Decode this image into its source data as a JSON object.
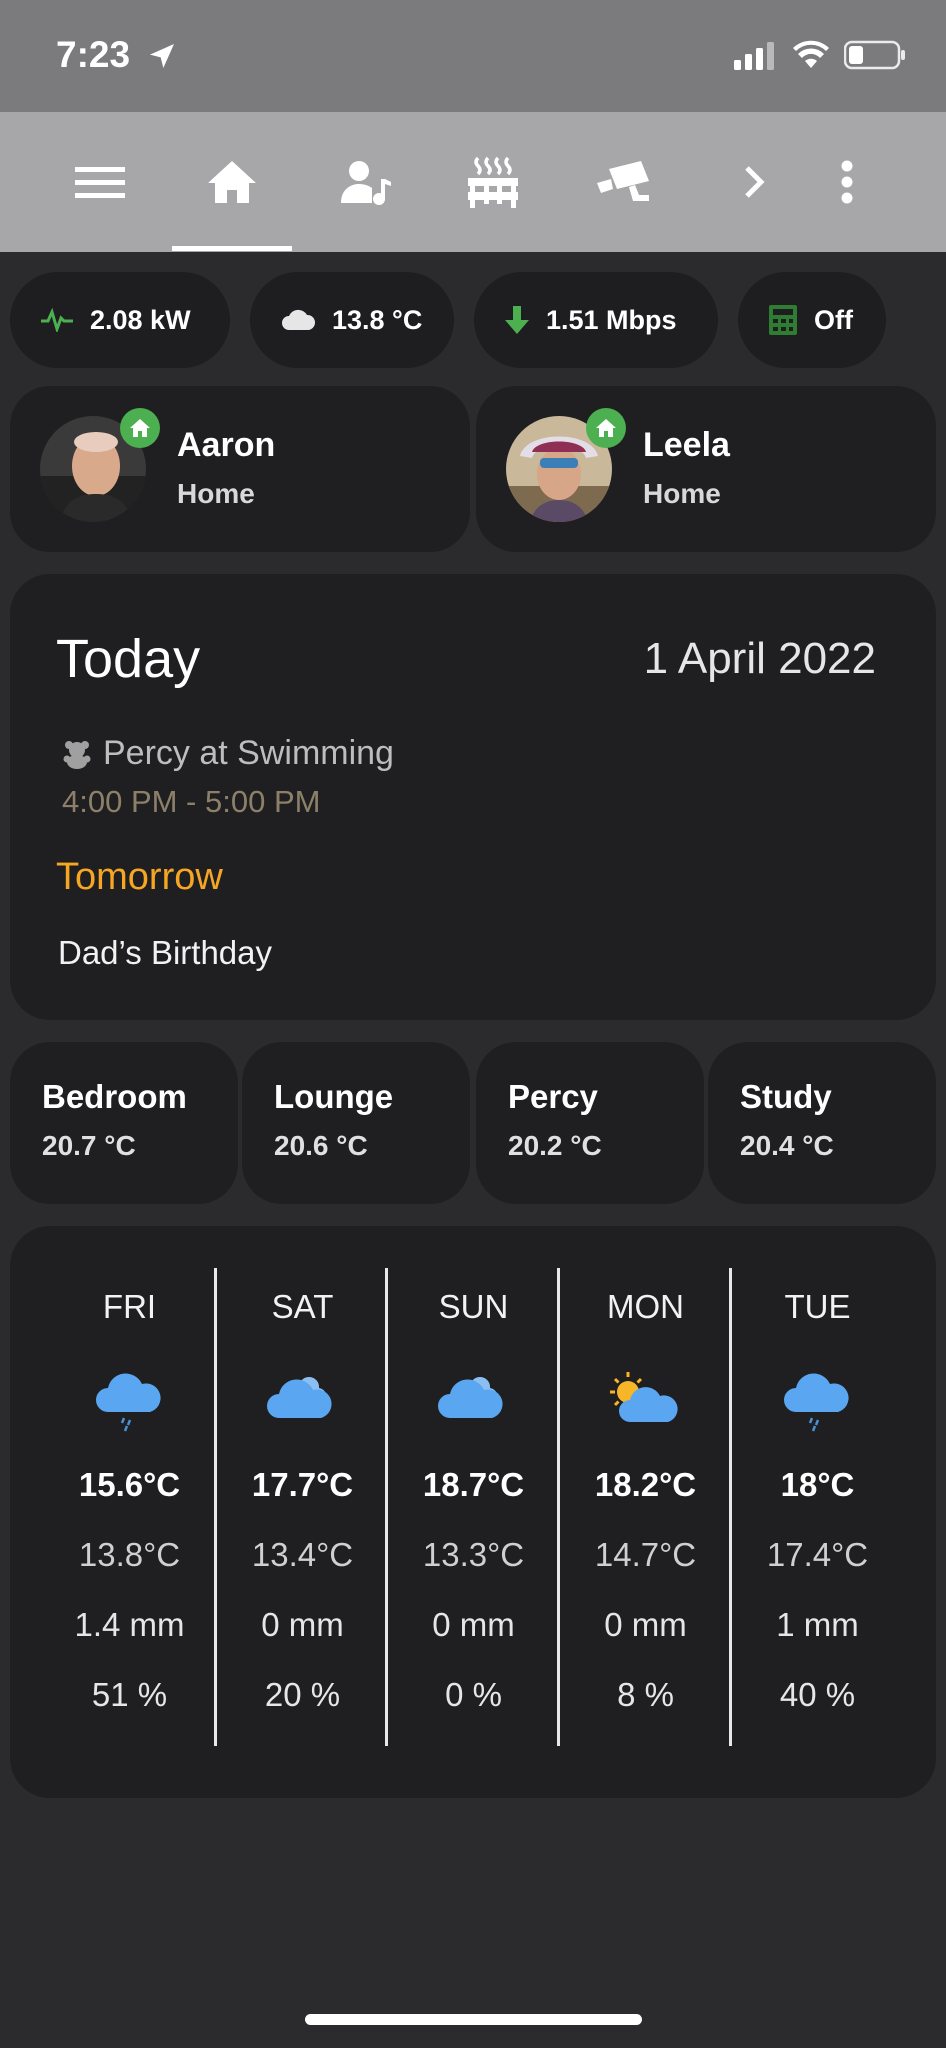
{
  "status_bar": {
    "time": "7:23"
  },
  "toolbar": {
    "icons": [
      "menu-icon",
      "home-icon",
      "person-music-icon",
      "radiator-icon",
      "camera-icon",
      "chevron-right-icon",
      "more-vert-icon"
    ]
  },
  "chips": [
    {
      "icon": "pulse-icon",
      "label": "2.08 kW",
      "color": "#4caf50"
    },
    {
      "icon": "cloud-icon",
      "label": "13.8 °C",
      "color": "#e0e0e0"
    },
    {
      "icon": "arrow-down-icon",
      "label": "1.51 Mbps",
      "color": "#4caf50"
    },
    {
      "icon": "calculator-icon",
      "label": "Off",
      "color": "#2e7d32"
    }
  ],
  "people": [
    {
      "name": "Aaron",
      "state": "Home"
    },
    {
      "name": "Leela",
      "state": "Home"
    }
  ],
  "calendar": {
    "today_label": "Today",
    "date": "1 April 2022",
    "event_title": "Percy at Swimming",
    "event_time": "4:00 PM - 5:00 PM",
    "tomorrow_label": "Tomorrow",
    "tomorrow_event": "Dad’s Birthday"
  },
  "rooms": [
    {
      "name": "Bedroom",
      "temp": "20.7 °C"
    },
    {
      "name": "Lounge",
      "temp": "20.6 °C"
    },
    {
      "name": "Percy",
      "temp": "20.2 °C"
    },
    {
      "name": "Study",
      "temp": "20.4 °C"
    }
  ],
  "forecast": [
    {
      "day": "FRI",
      "icon": "rain-cloud-icon",
      "high": "15.6°C",
      "low": "13.8°C",
      "rain": "1.4 mm",
      "chance": "51 %"
    },
    {
      "day": "SAT",
      "icon": "cloudy-icon",
      "high": "17.7°C",
      "low": "13.4°C",
      "rain": "0 mm",
      "chance": "20 %"
    },
    {
      "day": "SUN",
      "icon": "cloudy-icon",
      "high": "18.7°C",
      "low": "13.3°C",
      "rain": "0 mm",
      "chance": "0 %"
    },
    {
      "day": "MON",
      "icon": "partly-sunny-icon",
      "high": "18.2°C",
      "low": "14.7°C",
      "rain": "0 mm",
      "chance": "8 %"
    },
    {
      "day": "TUE",
      "icon": "rain-cloud-icon",
      "high": "18°C",
      "low": "17.4°C",
      "rain": "1 mm",
      "chance": "40 %"
    }
  ],
  "colors": {
    "accent": "#f5a623",
    "home_badge": "#4caf50",
    "weather_blue": "#5aa6f0"
  }
}
